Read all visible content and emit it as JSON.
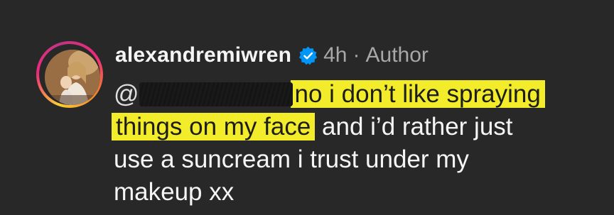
{
  "comment": {
    "username": "alexandremiwren",
    "verified_icon": "verified-badge-icon",
    "timestamp": "4h",
    "separator": "·",
    "role": "Author",
    "mention_prefix": "@",
    "highlight_color": "#f2ec2a",
    "line1_highlight": "no i don’t like spraying",
    "line2_highlight": "things on my face",
    "line2_rest": " and i’d rather just",
    "line3": "use a suncream i trust under my",
    "line4": "makeup xx"
  },
  "colors": {
    "background": "#282828",
    "text": "#f5f5f5",
    "muted": "#a8a8a8",
    "verified": "#0095f6"
  }
}
